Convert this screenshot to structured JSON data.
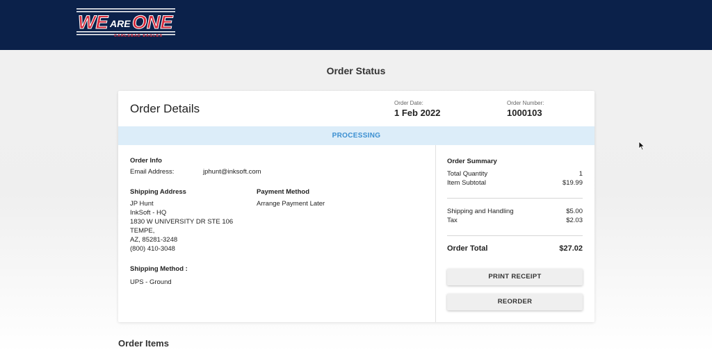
{
  "header": {
    "logo_text_we": "WE",
    "logo_text_are": "ARE",
    "logo_text_one": "ONE",
    "logo_subtitle": "CARLSBAD EAGLES"
  },
  "page": {
    "title": "Order Status"
  },
  "order": {
    "title": "Order Details",
    "date_label": "Order Date:",
    "date_value": "1 Feb 2022",
    "number_label": "Order Number:",
    "number_value": "1000103",
    "status": "PROCESSING"
  },
  "info": {
    "heading": "Order Info",
    "email_label": "Email Address:",
    "email_value": "jphunt@inksoft.com"
  },
  "shipping": {
    "heading": "Shipping Address",
    "lines": [
      "JP Hunt",
      "InkSoft - HQ",
      "1830 W UNIVERSITY DR STE 106",
      "TEMPE,",
      "AZ, 85281-3248",
      "(800) 410-3048"
    ],
    "method_heading": "Shipping Method :",
    "method_value": "UPS - Ground"
  },
  "payment": {
    "heading": "Payment Method",
    "value": "Arrange Payment Later"
  },
  "summary": {
    "heading": "Order Summary",
    "total_quantity_label": "Total Quantity",
    "total_quantity_value": "1",
    "subtotal_label": "Item Subtotal",
    "subtotal_value": "$19.99",
    "shipping_label": "Shipping and Handling",
    "shipping_value": "$5.00",
    "tax_label": "Tax",
    "tax_value": "$2.03",
    "total_label": "Order Total",
    "total_value": "$27.02"
  },
  "buttons": {
    "print_receipt": "PRINT RECEIPT",
    "reorder": "REORDER"
  },
  "order_items": {
    "title": "Order Items"
  },
  "colors": {
    "header_bg": "#0b214a",
    "logo_red": "#d6283a",
    "status_bg": "#dcedf9",
    "status_text": "#3b8fd1"
  }
}
